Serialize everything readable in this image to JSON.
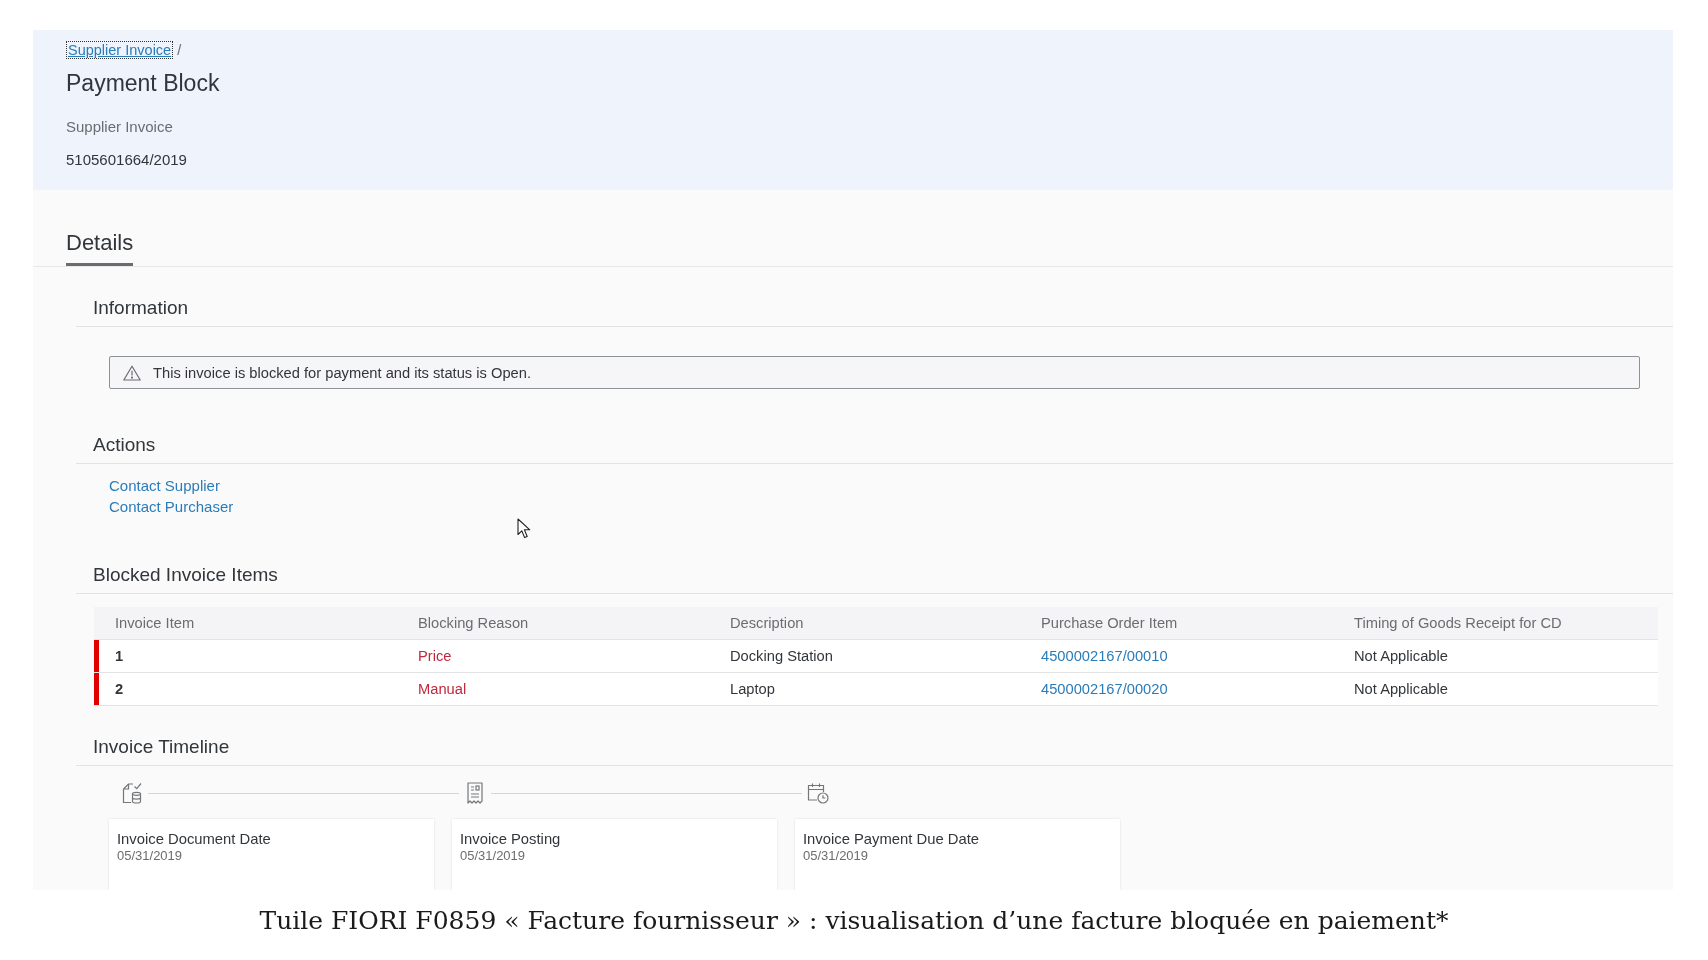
{
  "breadcrumb": {
    "items": [
      {
        "label": "Supplier Invoice",
        "focused": true
      }
    ],
    "separator": "/"
  },
  "title": "Payment Block",
  "header_field": {
    "label": "Supplier Invoice",
    "value": "5105601664/2019"
  },
  "tabs": [
    {
      "label": "Details",
      "selected": true
    }
  ],
  "information": {
    "title": "Information",
    "message": {
      "kind": "warning",
      "text": "This invoice is blocked for payment and its status is Open."
    }
  },
  "actions": {
    "title": "Actions",
    "links": [
      "Contact Supplier",
      "Contact Purchaser"
    ]
  },
  "blocked_items": {
    "title": "Blocked Invoice Items",
    "columns": [
      {
        "label": "Invoice Item",
        "kind": "id"
      },
      {
        "label": "Blocking Reason",
        "kind": "negative"
      },
      {
        "label": "Description",
        "kind": "text"
      },
      {
        "label": "Purchase Order Item",
        "kind": "link"
      },
      {
        "label": "Timing of Goods Receipt for CD",
        "kind": "text"
      }
    ],
    "rows": [
      {
        "error": true,
        "cells": [
          "1",
          "Price",
          "Docking Station",
          "4500002167/00010",
          "Not Applicable"
        ]
      },
      {
        "error": true,
        "cells": [
          "2",
          "Manual",
          "Laptop",
          "4500002167/00020",
          "Not Applicable"
        ]
      }
    ]
  },
  "timeline": {
    "title": "Invoice Timeline",
    "events": [
      {
        "kind": "document",
        "label": "Invoice Document Date",
        "date": "05/31/2019"
      },
      {
        "kind": "posting",
        "label": "Invoice Posting",
        "date": "05/31/2019"
      },
      {
        "kind": "due",
        "label": "Invoice Payment Due Date",
        "date": "05/31/2019"
      }
    ]
  },
  "caption": "Tuile FIORI F0859 « Facture fournisseur » : visualisation d’une facture bloquée en paiement*"
}
